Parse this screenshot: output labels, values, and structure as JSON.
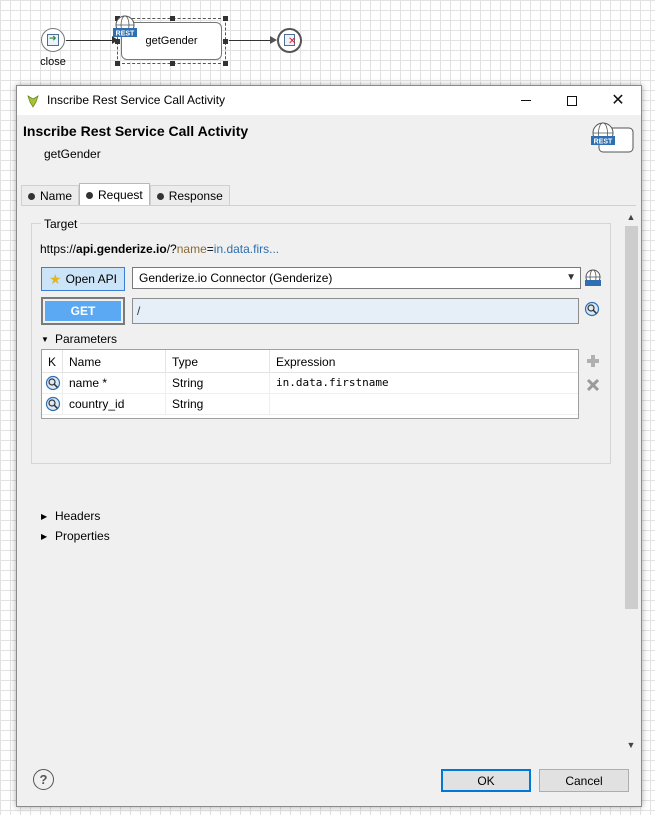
{
  "canvas": {
    "start_label": "close",
    "task_label": "getGender",
    "rest_badge": "REST"
  },
  "dialog": {
    "window_title": "Inscribe Rest Service Call Activity",
    "header_title": "Inscribe Rest Service Call Activity",
    "header_subtitle": "getGender",
    "header_icon_badge": "REST",
    "tabs": [
      {
        "label": "Name"
      },
      {
        "label": "Request"
      },
      {
        "label": "Response"
      }
    ],
    "active_tab": "Request",
    "target": {
      "group_label": "Target",
      "url_prefix": "https://",
      "url_host": "api.genderize.io",
      "url_path": "/?",
      "url_param": "name",
      "url_eq": "=",
      "url_expr": "in.data.firs...",
      "open_api_label": "Open API",
      "client_selected": "Genderize.io Connector (Genderize)",
      "method": "GET",
      "path": "/"
    },
    "parameters": {
      "section_label": "Parameters",
      "columns": [
        "K",
        "Name",
        "Type",
        "Expression"
      ],
      "rows": [
        {
          "name": "name *",
          "type": "String",
          "expression": "in.data.firstname"
        },
        {
          "name": "country_id",
          "type": "String",
          "expression": ""
        }
      ]
    },
    "headers_label": "Headers",
    "properties_label": "Properties",
    "ok_label": "OK",
    "cancel_label": "Cancel",
    "help_label": "?"
  },
  "colors": {
    "accent": "#0078d7",
    "get_button": "#5aa9f2",
    "open_api_bg": "#cce4f7",
    "url_param": "#8a6a34",
    "url_expr": "#2f6fb0"
  }
}
